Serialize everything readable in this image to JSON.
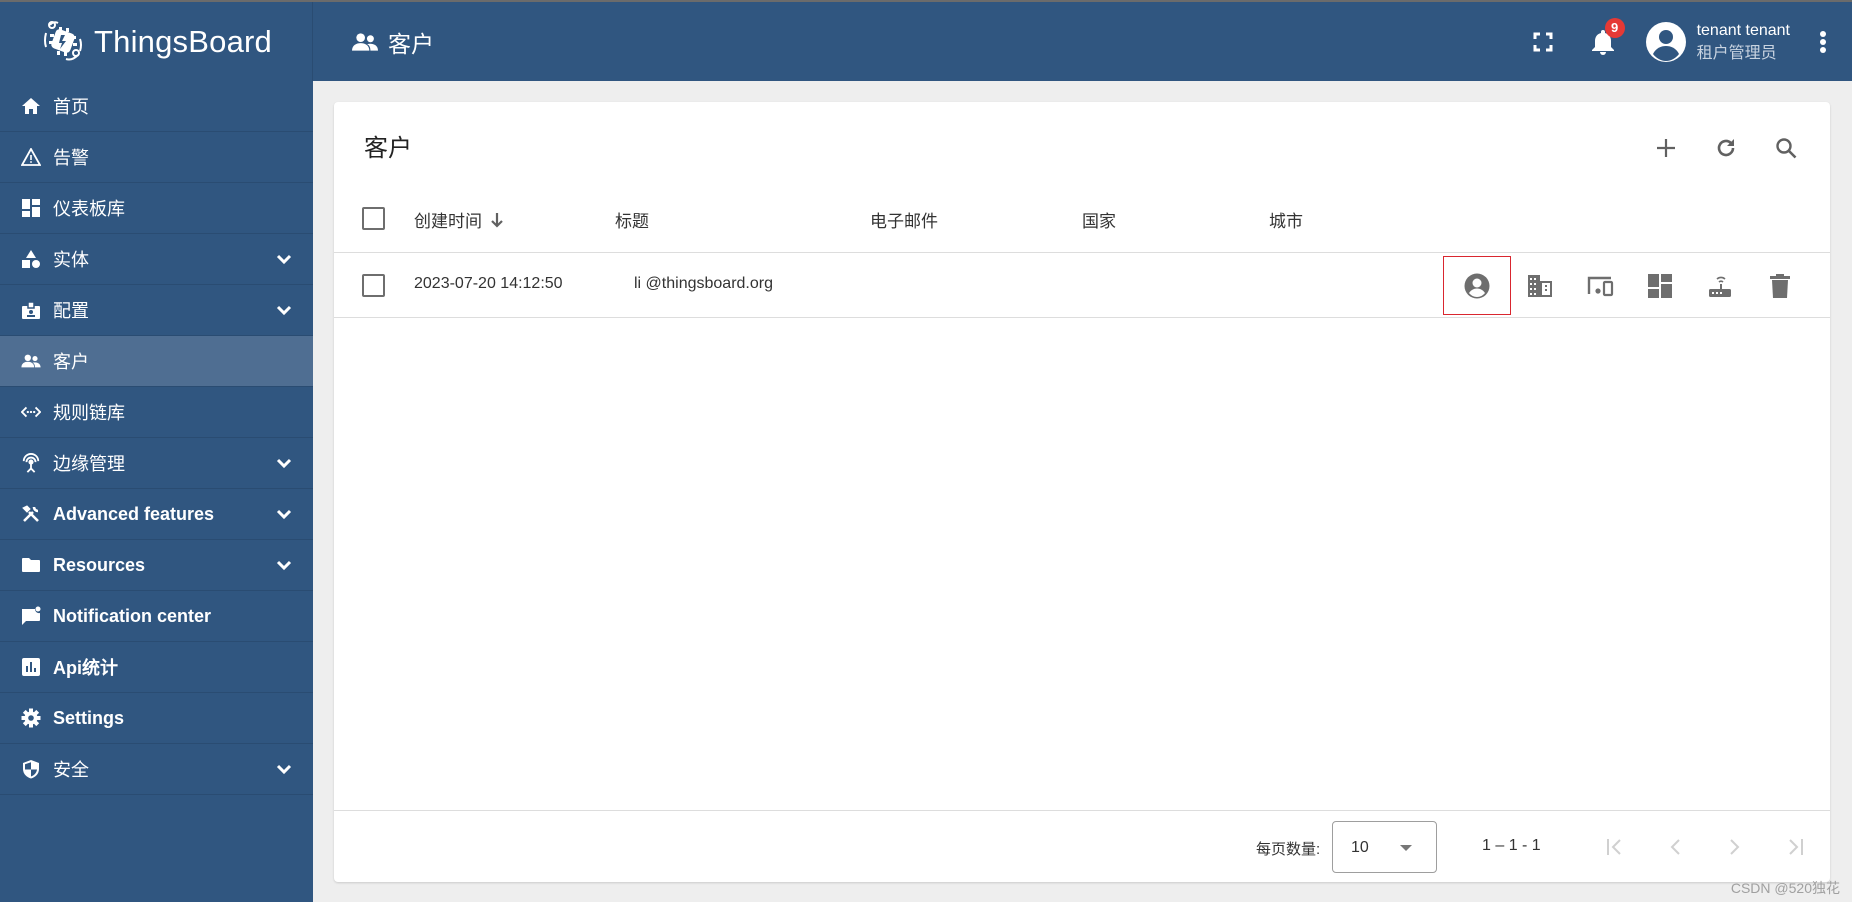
{
  "app": {
    "brand": "ThingsBoard",
    "page_title": "客户"
  },
  "topbar": {
    "notification_count": "9",
    "user_name": "tenant tenant",
    "user_role": "租户管理员"
  },
  "sidebar": {
    "items": [
      {
        "label": "首页",
        "icon": "home-icon",
        "expandable": false
      },
      {
        "label": "告警",
        "icon": "warning-icon",
        "expandable": false
      },
      {
        "label": "仪表板库",
        "icon": "dashboard-icon",
        "expandable": false
      },
      {
        "label": "实体",
        "icon": "category-icon",
        "expandable": true
      },
      {
        "label": "配置",
        "icon": "badge-icon",
        "expandable": true
      },
      {
        "label": "客户",
        "icon": "supervisor-account-icon",
        "expandable": false,
        "active": true
      },
      {
        "label": "规则链库",
        "icon": "settings-ethernet-icon",
        "expandable": false
      },
      {
        "label": "边缘管理",
        "icon": "router-icon",
        "expandable": true
      },
      {
        "label": "Advanced features",
        "icon": "construction-icon",
        "expandable": true
      },
      {
        "label": "Resources",
        "icon": "folder-icon",
        "expandable": true
      },
      {
        "label": "Notification center",
        "icon": "mark-chat-unread-icon",
        "expandable": false
      },
      {
        "label": "Api统计",
        "icon": "insert-chart-icon",
        "expandable": false
      },
      {
        "label": "Settings",
        "icon": "gear-icon",
        "expandable": false
      },
      {
        "label": "安全",
        "icon": "security-icon",
        "expandable": true
      }
    ]
  },
  "card": {
    "title": "客户",
    "table": {
      "columns": [
        "创建时间",
        "标题",
        "电子邮件",
        "国家",
        "城市"
      ],
      "sort_column": "创建时间",
      "sort_direction": "desc",
      "rows": [
        {
          "created": "2023-07-20 14:12:50",
          "title": "li @thingsboard.org",
          "email": "",
          "country": "",
          "city": ""
        }
      ],
      "row_actions": [
        "account-circle-icon",
        "domain-icon",
        "devices-other-icon",
        "dashboard-icon",
        "router-icon",
        "delete-icon"
      ]
    },
    "footer": {
      "per_page_label": "每页数量:",
      "per_page_value": "10",
      "range_text": "1 – 1 - 1"
    }
  },
  "watermark": "CSDN @520独花",
  "colors": {
    "primary": "#305680",
    "active_item": "#4f6e92",
    "highlight_box": "#d9262f",
    "badge": "#e53935"
  }
}
